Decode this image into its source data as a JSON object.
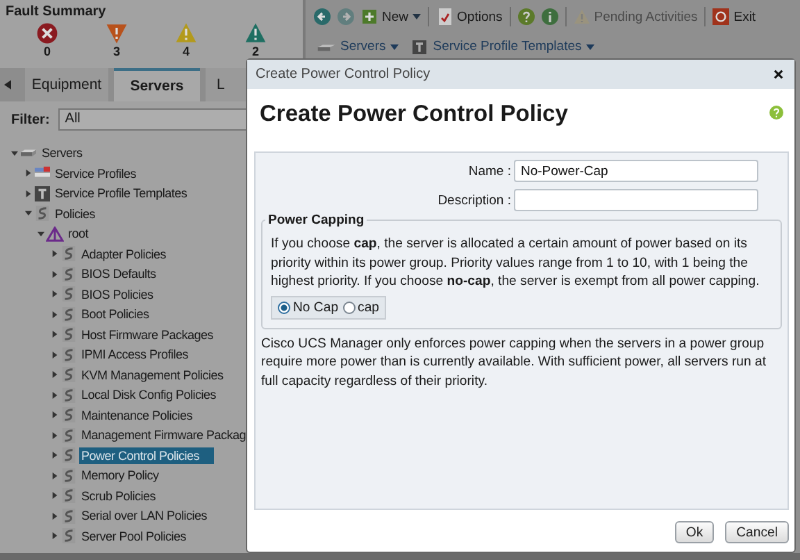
{
  "fault_summary": {
    "title": "Fault Summary",
    "counts": [
      {
        "kind": "critical",
        "count": "0"
      },
      {
        "kind": "major",
        "count": "3"
      },
      {
        "kind": "minor",
        "count": "4"
      },
      {
        "kind": "warning",
        "count": "2"
      }
    ]
  },
  "nav_tabs": [
    {
      "label": "Equipment",
      "selected": false
    },
    {
      "label": "Servers",
      "selected": true
    },
    {
      "label": "L",
      "selected": false
    }
  ],
  "filter": {
    "label": "Filter:",
    "value": "All"
  },
  "tree": [
    {
      "label": "Servers",
      "expanded": true,
      "selected": false,
      "children": [
        {
          "label": "Service Profiles",
          "expanded": false,
          "selected": false
        },
        {
          "label": "Service Profile Templates",
          "expanded": false,
          "selected": false
        },
        {
          "label": "Policies",
          "expanded": true,
          "selected": false,
          "children": [
            {
              "label": "root",
              "expanded": true,
              "selected": false,
              "children": [
                {
                  "label": "Adapter Policies",
                  "expanded": false,
                  "selected": false
                },
                {
                  "label": "BIOS Defaults",
                  "expanded": false,
                  "selected": false
                },
                {
                  "label": "BIOS Policies",
                  "expanded": false,
                  "selected": false
                },
                {
                  "label": "Boot Policies",
                  "expanded": false,
                  "selected": false
                },
                {
                  "label": "Host Firmware Packages",
                  "expanded": false,
                  "selected": false
                },
                {
                  "label": "IPMI Access Profiles",
                  "expanded": false,
                  "selected": false
                },
                {
                  "label": "KVM Management Policies",
                  "expanded": false,
                  "selected": false
                },
                {
                  "label": "Local Disk Config Policies",
                  "expanded": false,
                  "selected": false
                },
                {
                  "label": "Maintenance Policies",
                  "expanded": false,
                  "selected": false
                },
                {
                  "label": "Management Firmware Packag",
                  "expanded": false,
                  "selected": false
                },
                {
                  "label": "Power Control Policies",
                  "expanded": false,
                  "selected": true
                },
                {
                  "label": "Memory Policy",
                  "expanded": false,
                  "selected": false
                },
                {
                  "label": "Scrub Policies",
                  "expanded": false,
                  "selected": false
                },
                {
                  "label": "Serial over LAN Policies",
                  "expanded": false,
                  "selected": false
                },
                {
                  "label": "Server Pool Policies",
                  "expanded": false,
                  "selected": false
                }
              ]
            }
          ]
        }
      ]
    }
  ],
  "toolbar": [
    {
      "kind": "back",
      "disabled": false
    },
    {
      "kind": "forward",
      "disabled": true
    },
    {
      "kind": "new",
      "label": "New",
      "disabled": false
    },
    {
      "kind": "options",
      "label": "Options",
      "disabled": false
    },
    {
      "kind": "help",
      "disabled": false
    },
    {
      "kind": "info",
      "disabled": false
    },
    {
      "kind": "pending",
      "label": "Pending Activities",
      "disabled": true
    },
    {
      "kind": "exit",
      "label": "Exit",
      "disabled": false
    }
  ],
  "breadcrumb": [
    {
      "kind": "server",
      "label": "Servers"
    },
    {
      "kind": "template",
      "label": "Service Profile Templates"
    }
  ],
  "dialog": {
    "window_title": "Create Power Control Policy",
    "heading": "Create Power Control Policy",
    "fields": [
      {
        "label": "Name :",
        "value": "No-Power-Cap"
      },
      {
        "label": "Description :"
      }
    ],
    "power_capping": {
      "legend": "Power Capping",
      "text": "If you choose **cap**, the server is allocated a certain amount of power based on its priority within its power group. Priority values range from 1 to 10, with 1 being the highest priority. If you choose **no-cap**, the server is exempt from all power capping.",
      "options": [
        {
          "label": "No Cap",
          "selected": true
        },
        {
          "label": "cap",
          "selected": false
        }
      ]
    },
    "note": "Cisco UCS Manager only enforces power capping when the servers in a power group require more power than is currently available. With sufficient power, all servers run at full capacity regardless of their priority.",
    "buttons": [
      {
        "label": "Ok"
      },
      {
        "label": "Cancel"
      }
    ]
  }
}
